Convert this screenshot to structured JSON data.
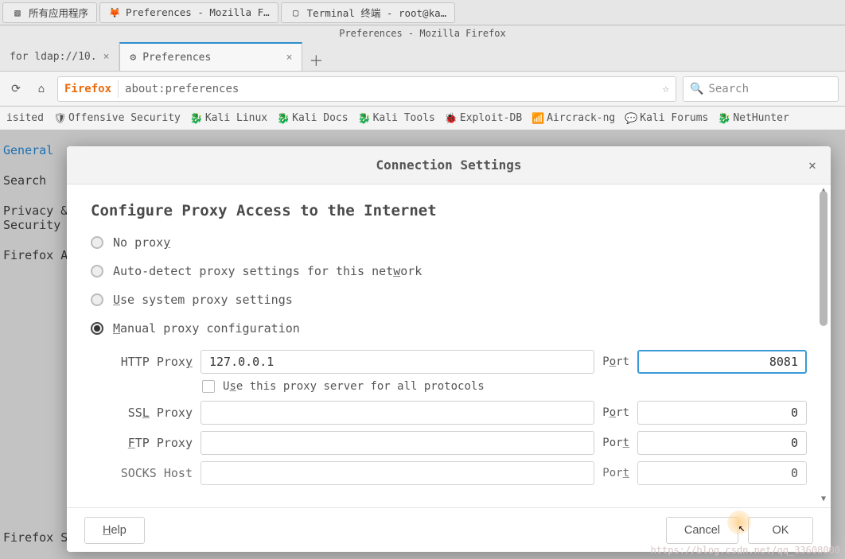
{
  "taskbar": {
    "apps_button": "所有应用程序",
    "items": [
      {
        "label": "Preferences - Mozilla F…",
        "icon": "firefox"
      },
      {
        "label": "Terminal 终端 - root@ka…",
        "icon": "terminal"
      }
    ]
  },
  "window_title": "Preferences - Mozilla Firefox",
  "tabs": [
    {
      "label": "for ldap://10.",
      "active": false
    },
    {
      "label": "Preferences",
      "active": true
    }
  ],
  "urlbar": {
    "brand": "Firefox",
    "url": "about:preferences"
  },
  "search_placeholder": "Search",
  "bookmarks": [
    "isited",
    "Offensive Security",
    "Kali Linux",
    "Kali Docs",
    "Kali Tools",
    "Exploit-DB",
    "Aircrack-ng",
    "Kali Forums",
    "NetHunter"
  ],
  "sidebar": {
    "items": [
      "General",
      "Search",
      "Privacy & Security",
      "Firefox A"
    ],
    "active_index": 0,
    "footer": "Firefox Su"
  },
  "dialog": {
    "title": "Connection Settings",
    "heading": "Configure Proxy Access to the Internet",
    "radios": [
      {
        "label_pre": "No prox",
        "label_under": "y",
        "label_post": "",
        "selected": false
      },
      {
        "label_pre": "Auto-detect proxy settings for this net",
        "label_under": "w",
        "label_post": "ork",
        "selected": false
      },
      {
        "label_pre": "",
        "label_under": "U",
        "label_post": "se system proxy settings",
        "selected": false
      },
      {
        "label_pre": "",
        "label_under": "M",
        "label_post": "anual proxy configuration",
        "selected": true
      }
    ],
    "fields": {
      "http": {
        "label_pre": "HTTP Prox",
        "label_under": "y",
        "value": "127.0.0.1",
        "port_pre": "P",
        "port_under": "o",
        "port_post": "rt",
        "port": "8081",
        "focused": true
      },
      "useall": {
        "label_pre": "U",
        "label_under": "s",
        "label_post": "e this proxy server for all protocols",
        "checked": false
      },
      "ssl": {
        "label_pre": "SS",
        "label_under": "L",
        "label_post": " Proxy",
        "value": "",
        "port_pre": "P",
        "port_under": "o",
        "port_post": "rt",
        "port": "0"
      },
      "ftp": {
        "label_pre": "",
        "label_under": "F",
        "label_post": "TP Proxy",
        "value": "",
        "port_pre": "Por",
        "port_under": "t",
        "port_post": "",
        "port": "0"
      },
      "socks": {
        "label": "SOCKS Host",
        "value": "",
        "port_pre": "Por",
        "port_under": "t",
        "port_post": "",
        "port": "0"
      }
    },
    "buttons": {
      "help": "Help",
      "cancel": "Cancel",
      "ok": "OK"
    }
  },
  "watermark": "https://blog.csdn.net/qq_33608000"
}
